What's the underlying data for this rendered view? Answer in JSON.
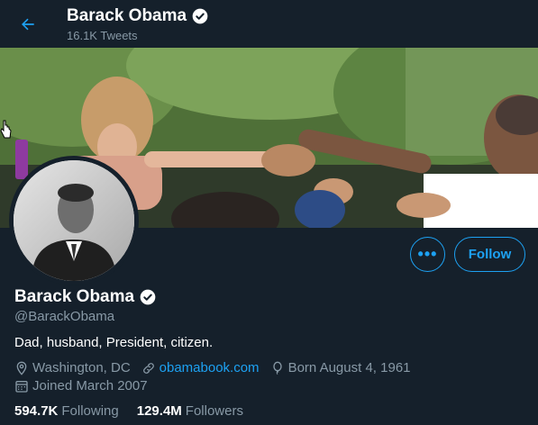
{
  "header": {
    "name": "Barack Obama",
    "tweet_count": "16.1K Tweets"
  },
  "profile": {
    "name": "Barack Obama",
    "handle": "@BarackObama",
    "bio": "Dad, husband, President, citizen.",
    "location": "Washington, DC",
    "website": "obamabook.com",
    "born": "Born August 4, 1961",
    "joined": "Joined March 2007"
  },
  "actions": {
    "more_label": "•••",
    "follow_label": "Follow"
  },
  "stats": {
    "following_count": "594.7K",
    "following_label": "Following",
    "followers_count": "129.4M",
    "followers_label": "Followers"
  },
  "colors": {
    "background": "#15202b",
    "accent": "#1da1f2",
    "secondary_text": "#8899a6"
  },
  "icons": [
    "back-arrow-icon",
    "verified-badge-icon",
    "location-icon",
    "link-icon",
    "balloon-icon",
    "calendar-icon"
  ]
}
